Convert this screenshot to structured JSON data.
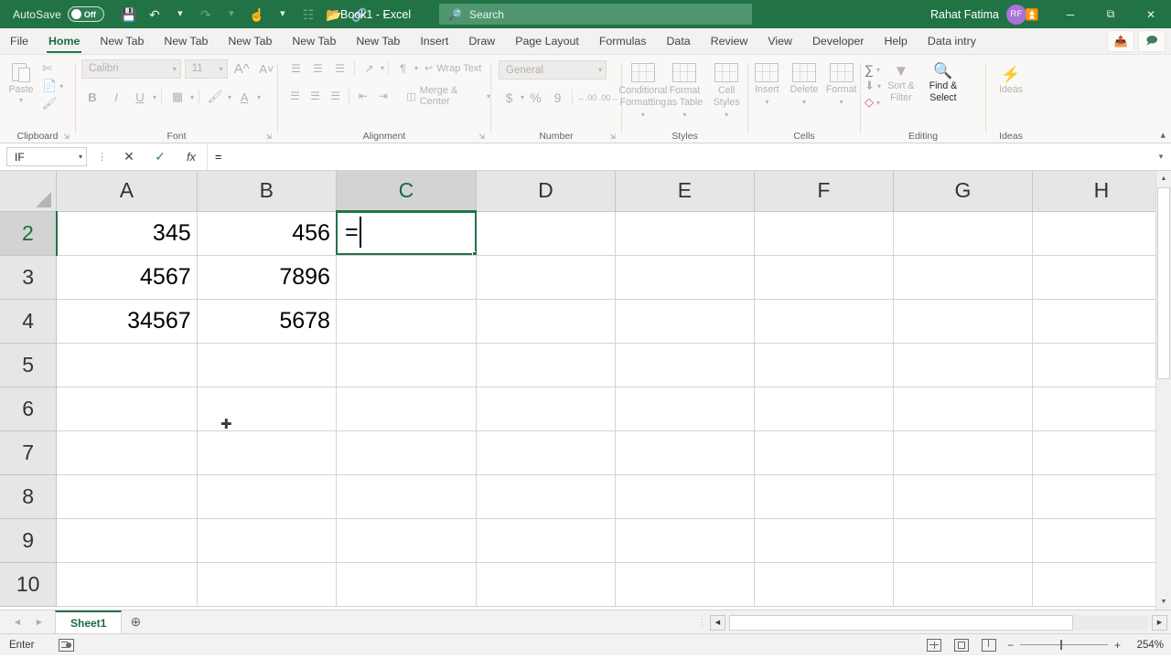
{
  "titlebar": {
    "autosave_label": "AutoSave",
    "autosave_state": "Off",
    "document_title": "Book1  -  Excel",
    "search_placeholder": "Search",
    "account_name": "Rahat Fatima",
    "account_initials": "RF",
    "quick_access": [
      "save-icon",
      "undo-icon",
      "redo-icon",
      "touch-mode-icon",
      "calculate-icon",
      "open-icon",
      "link-icon",
      "customize-icon"
    ],
    "window_buttons": [
      "ribbon-display-options",
      "minimize",
      "restore",
      "close"
    ]
  },
  "tabs": [
    {
      "label": "File",
      "active": false
    },
    {
      "label": "Home",
      "active": true
    },
    {
      "label": "New Tab",
      "active": false
    },
    {
      "label": "New Tab",
      "active": false
    },
    {
      "label": "New Tab",
      "active": false
    },
    {
      "label": "New Tab",
      "active": false
    },
    {
      "label": "New Tab",
      "active": false
    },
    {
      "label": "Insert",
      "active": false
    },
    {
      "label": "Draw",
      "active": false
    },
    {
      "label": "Page Layout",
      "active": false
    },
    {
      "label": "Formulas",
      "active": false
    },
    {
      "label": "Data",
      "active": false
    },
    {
      "label": "Review",
      "active": false
    },
    {
      "label": "View",
      "active": false
    },
    {
      "label": "Developer",
      "active": false
    },
    {
      "label": "Help",
      "active": false
    },
    {
      "label": "Data intry",
      "active": false
    }
  ],
  "ribbon": {
    "share_icon": "share-icon",
    "comments_icon": "comments-icon",
    "groups": {
      "clipboard": {
        "label": "Clipboard",
        "paste": "Paste",
        "cut": "cut-icon",
        "copy": "copy-icon",
        "format_painter": "format-painter-icon"
      },
      "font": {
        "label": "Font",
        "font_name": "Calibri",
        "font_size": "11",
        "grow_font": "A",
        "shrink_font": "A",
        "bold": "B",
        "italic": "I",
        "underline": "U",
        "borders": "borders-icon",
        "fill_color": "fill-color-icon",
        "font_color": "A"
      },
      "alignment": {
        "label": "Alignment",
        "wrap_text": "Wrap Text",
        "merge_center": "Merge & Center",
        "orientation": "orientation-icon",
        "indent": "indent-icon"
      },
      "number": {
        "label": "Number",
        "format": "General",
        "currency": "$",
        "percent": "%",
        "comma": "9",
        "increase_decimal": ".00",
        "decrease_decimal": ".00"
      },
      "styles": {
        "label": "Styles",
        "conditional_formatting": "Conditional Formatting",
        "format_as_table": "Format as Table",
        "cell_styles": "Cell Styles"
      },
      "cells": {
        "label": "Cells",
        "insert": "Insert",
        "delete": "Delete",
        "format": "Format"
      },
      "editing": {
        "label": "Editing",
        "autosum": "autosum-icon",
        "fill": "fill-icon",
        "clear": "clear-icon",
        "sort_filter": "Sort & Filter",
        "find_select": "Find & Select"
      },
      "ideas": {
        "label": "Ideas",
        "ideas_button": "Ideas"
      }
    }
  },
  "formula_bar": {
    "name_box": "IF",
    "cancel": "cancel-icon",
    "enter": "enter-icon",
    "insert_function": "fx",
    "formula": "="
  },
  "grid": {
    "columns": [
      "A",
      "B",
      "C",
      "D",
      "E",
      "F",
      "G",
      "H"
    ],
    "selected_column": "C",
    "rows": [
      {
        "header": "2",
        "cells": [
          "345",
          "456",
          "=",
          "",
          "",
          "",
          "",
          ""
        ]
      },
      {
        "header": "3",
        "cells": [
          "4567",
          "7896",
          "",
          "",
          "",
          "",
          "",
          ""
        ]
      },
      {
        "header": "4",
        "cells": [
          "34567",
          "5678",
          "",
          "",
          "",
          "",
          "",
          ""
        ]
      },
      {
        "header": "5",
        "cells": [
          "",
          "",
          "",
          "",
          "",
          "",
          "",
          ""
        ]
      },
      {
        "header": "6",
        "cells": [
          "",
          "",
          "",
          "",
          "",
          "",
          "",
          ""
        ]
      },
      {
        "header": "7",
        "cells": [
          "",
          "",
          "",
          "",
          "",
          "",
          "",
          ""
        ]
      },
      {
        "header": "8",
        "cells": [
          "",
          "",
          "",
          "",
          "",
          "",
          "",
          ""
        ]
      },
      {
        "header": "9",
        "cells": [
          "",
          "",
          "",
          "",
          "",
          "",
          "",
          ""
        ]
      },
      {
        "header": "10",
        "cells": [
          "",
          "",
          "",
          "",
          "",
          "",
          "",
          ""
        ]
      }
    ],
    "selected_row": "2",
    "active_cell": "C2",
    "active_cell_content": "="
  },
  "sheet_bar": {
    "sheets": [
      {
        "name": "Sheet1",
        "active": true
      }
    ],
    "add_sheet": "+",
    "prev": "prev-sheet-icon",
    "next": "next-sheet-icon"
  },
  "status_bar": {
    "mode": "Enter",
    "macro_record": "record-macro-icon",
    "view_normal": "normal-view-icon",
    "view_page_layout": "page-layout-view-icon",
    "view_page_break": "page-break-view-icon",
    "zoom_out": "−",
    "zoom_in": "+",
    "zoom_level": "254%"
  },
  "colors": {
    "accent": "#217346",
    "titlebar": "#217346",
    "ribbon_bg": "#f9f8f7",
    "avatar": "#a972d6"
  }
}
